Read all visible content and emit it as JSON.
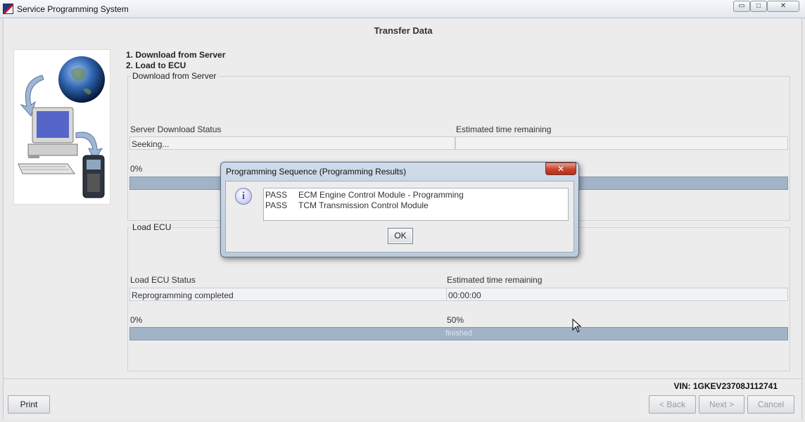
{
  "window": {
    "title": "Service Programming System",
    "controls": {
      "minimize": "▭",
      "maximize": "□",
      "close": "✕"
    }
  },
  "page": {
    "title": "Transfer Data"
  },
  "steps": [
    "1. Download from Server",
    "2. Load to ECU"
  ],
  "download_group": {
    "legend": "Download from Server",
    "status_label": "Server Download Status",
    "status_value": "Seeking...",
    "time_label": "Estimated time remaining",
    "time_value": "",
    "progress_label": "0%",
    "progress_fraction": 0.0
  },
  "load_group": {
    "legend": "Load ECU",
    "status_label": "Load ECU Status",
    "status_value": "Reprogramming completed",
    "time_label": "Estimated time remaining",
    "time_value": "00:00:00",
    "progress_start_label": "0%",
    "progress_mid_label": "50%",
    "progress_text": "finished",
    "progress_fraction": 1.0
  },
  "vin": "VIN: 1GKEV23708J112741",
  "buttons": {
    "print": "Print",
    "back": "< Back",
    "next": "Next >",
    "cancel": "Cancel"
  },
  "dialog": {
    "title": "Programming Sequence (Programming Results)",
    "close": "✕",
    "icon": "info-icon",
    "results": [
      {
        "status": "PASS",
        "text": "ECM Engine Control Module - Programming"
      },
      {
        "status": "PASS",
        "text": "TCM Transmission Control Module"
      }
    ],
    "ok": "OK"
  },
  "colors": {
    "progress_bar": "#a1b3c6",
    "dialog_frame": "#bccbdc",
    "close_button": "#c8412a"
  }
}
